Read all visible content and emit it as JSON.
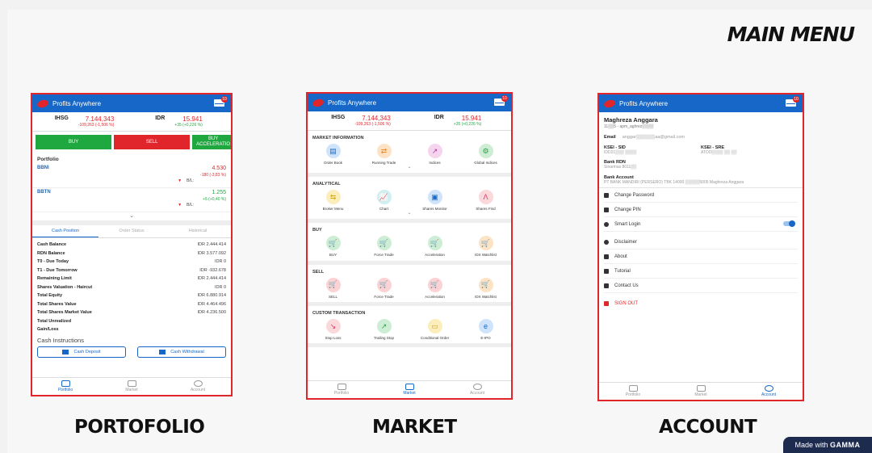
{
  "main_title": "MAIN MENU",
  "captions": {
    "portfolio": "PORTOFOLIO",
    "market": "MARKET",
    "account": "ACCOUNT"
  },
  "footer": {
    "made_with": "Made with",
    "brand": "GAMMA"
  },
  "app": {
    "name": "Profits Anywhere",
    "badge": "10"
  },
  "ticker": {
    "ihsg": {
      "name": "IHSG",
      "value": "7.144,343",
      "change": "-109,263 (-1,506 %)"
    },
    "idr": {
      "name": "IDR",
      "value": "15.941",
      "change": "+35 (+0,226 %)"
    }
  },
  "portfolio": {
    "buttons": {
      "buy": "BUY",
      "sell": "SELL",
      "buy_accel": "BUY ACCELERATIO"
    },
    "section_title": "Portfolio",
    "holdings": [
      {
        "code": "BBNI",
        "value": "4.530",
        "change": "-180 (-3,83 %)",
        "bl": "B/L:"
      },
      {
        "code": "BBTN",
        "value": "1.255",
        "change": "+5 (+0,40 %)",
        "bl": "B/L:"
      }
    ],
    "chevron": "⌄",
    "tabs": [
      "Cash Position",
      "Order Status",
      "Historical"
    ],
    "cash_rows": [
      {
        "label": "Cash Balance",
        "value": "IDR 2.444.414"
      },
      {
        "label": "RDN Balance",
        "value": "IDR 3.577.092"
      },
      {
        "label": "T0 - Due Today",
        "value": "IDR 0"
      },
      {
        "label": "T1 - Due Tomorrow",
        "value": "IDR -932.678"
      },
      {
        "label": "Remaining Limit",
        "value": "IDR 2.444.414"
      },
      {
        "label": "Shares Valuation - Haircut",
        "value": "IDR 0"
      },
      {
        "label": "Total Equity",
        "value": "IDR 6.880.914"
      },
      {
        "label": "Total Shares Value",
        "value": "IDR 4.464.496"
      },
      {
        "label": "Total Shares Market Value",
        "value": "IDR 4.236.500"
      },
      {
        "label": "Total Unrealized",
        "value": ""
      },
      {
        "label": "Gain/Loss",
        "value": ""
      }
    ],
    "cash_instructions": "Cash Instructions",
    "cash_deposit": "Cash Deposit",
    "cash_withdrawal": "Cash Withdrawal"
  },
  "market": {
    "sections": [
      {
        "title": "MARKET INFORMATION",
        "items": [
          {
            "label": "Order Book",
            "color": "c-blue",
            "glyph": "▤"
          },
          {
            "label": "Running Trade",
            "color": "c-orange",
            "glyph": "⇄"
          },
          {
            "label": "Indices",
            "color": "c-purple",
            "glyph": "↗"
          },
          {
            "label": "Global Indices",
            "color": "c-green",
            "glyph": "⚙"
          }
        ],
        "chevron": "⌄"
      },
      {
        "title": "ANALYTICAL",
        "items": [
          {
            "label": "Broker Menu",
            "color": "c-yellow",
            "glyph": "⇆"
          },
          {
            "label": "Chart",
            "color": "c-teal",
            "glyph": "📈"
          },
          {
            "label": "Shares Monitor",
            "color": "c-blue",
            "glyph": "▣"
          },
          {
            "label": "Shares Find",
            "color": "c-pink",
            "glyph": "Λ"
          }
        ],
        "chevron": "⌄"
      },
      {
        "title": "BUY",
        "items": [
          {
            "label": "BUY",
            "color": "c-green",
            "glyph": "🛒"
          },
          {
            "label": "Force Trade",
            "color": "c-green",
            "glyph": "🛒"
          },
          {
            "label": "Acceleration",
            "color": "c-green",
            "glyph": "🛒"
          },
          {
            "label": "IDX Watchlist",
            "color": "c-orange",
            "glyph": "🛒"
          }
        ],
        "chevron": ""
      },
      {
        "title": "SELL",
        "items": [
          {
            "label": "SELL",
            "color": "c-red",
            "glyph": "🛒"
          },
          {
            "label": "Force Trade",
            "color": "c-red",
            "glyph": "🛒"
          },
          {
            "label": "Acceleration",
            "color": "c-red",
            "glyph": "🛒"
          },
          {
            "label": "IDX Watchlist",
            "color": "c-orange",
            "glyph": "🛒"
          }
        ],
        "chevron": ""
      },
      {
        "title": "CUSTOM TRANSACTION",
        "items": [
          {
            "label": "Stop Loss",
            "color": "c-pink",
            "glyph": "↘"
          },
          {
            "label": "Trailing Stop",
            "color": "c-green",
            "glyph": "↗"
          },
          {
            "label": "Conditional Order",
            "color": "c-yellow",
            "glyph": "▭"
          },
          {
            "label": "E-IPO",
            "color": "c-blue",
            "glyph": "e"
          }
        ],
        "chevron": ""
      }
    ]
  },
  "account": {
    "name": "Maghreza Anggara",
    "id_line": "11▒▒5 - apm_aghrez▒▒▒▒",
    "email_label": "Email",
    "email_value": "anggar▒▒▒▒▒▒aa@gmail.com",
    "ksei_sid_label": "KSEI - SID",
    "ksei_sid_value": "IDD21▒▒▒ ▒▒▒▒",
    "ksei_sre_label": "KSEI - SRE",
    "ksei_sre_value": "ATOD▒▒▒▒ ▒▒ ▒▒",
    "bank_rdn_label": "Bank RDN",
    "bank_rdn_value": "Sinarmas 8011▒▒",
    "bank_account_label": "Bank Account",
    "bank_account_value": "PT BANK MANDIRI (PERSERO) TBK 14000 ▒▒▒▒▒5005 Maghreza Anggara",
    "menu": [
      "Change Password",
      "Change PIN",
      "Smart Login",
      "Disclaimer",
      "About",
      "Tutorial",
      "Contact Us"
    ],
    "sign_out": "SIGN OUT"
  },
  "bottom_nav": [
    "Portfolio",
    "Market",
    "Account"
  ]
}
